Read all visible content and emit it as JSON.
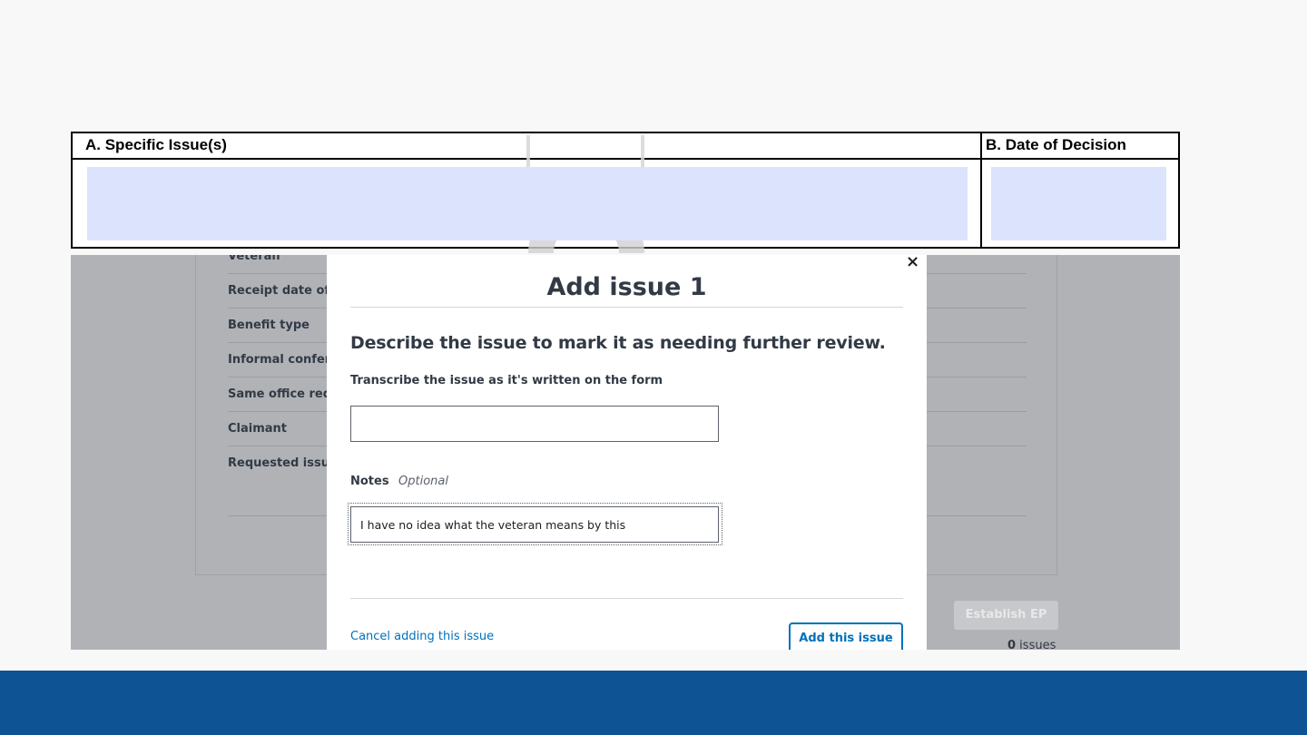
{
  "form": {
    "col_a_header": "A. Specific Issue(s)",
    "col_b_header": "B. Date of Decision",
    "highlight_color": "#dce3fc"
  },
  "app": {
    "rows": [
      "Veteran",
      "Receipt date of this form",
      "Benefit type",
      "Informal conference",
      "Same office requested",
      "Claimant",
      "Requested issues"
    ],
    "establish_button": "Establish EP",
    "issue_count_number": "0",
    "issue_count_label": " issues"
  },
  "modal": {
    "close_glyph": "×",
    "title": "Add issue 1",
    "description": "Describe the issue to mark it as needing further review.",
    "issue_label": "Transcribe the issue as it's written on the form",
    "issue_value": "",
    "notes_label": "Notes",
    "notes_optional": "Optional",
    "notes_value": "I have no idea what the veteran means by this",
    "cancel_link": "Cancel adding this issue",
    "add_button": "Add this issue"
  },
  "colors": {
    "link_blue": "#0071bb",
    "footer_blue": "#0e5394",
    "overlay_gray": "#b0b2b6"
  }
}
